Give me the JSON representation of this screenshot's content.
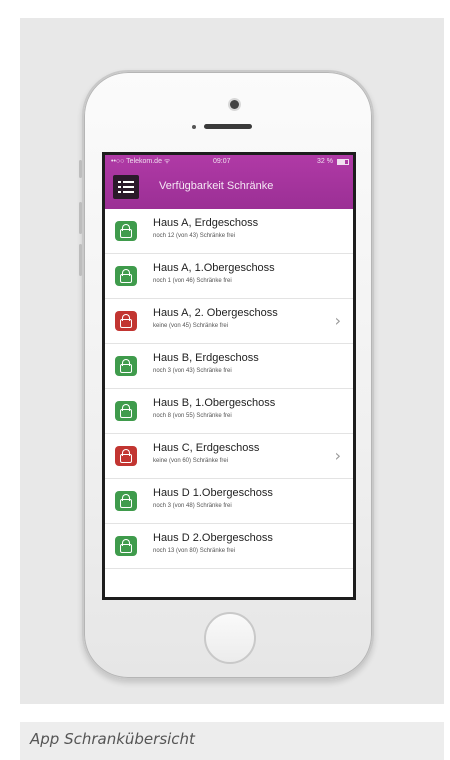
{
  "caption": "App Schrankübersicht",
  "status_bar": {
    "carrier": "••○○ Telekom.de ᯤ",
    "time": "09:07",
    "battery_text": "32 %"
  },
  "header": {
    "title": "Verfügbarkeit Schränke",
    "accent_color": "#a5359d"
  },
  "status_colors": {
    "available": "#3f9b4c",
    "full": "#c23531"
  },
  "rows": [
    {
      "title": "Haus A, Erdgeschoss",
      "subtitle": "noch 12 (von 43) Schränke frei",
      "status": "available",
      "icon": "lock-icon",
      "chevron": false
    },
    {
      "title": "Haus A, 1.Obergeschoss",
      "subtitle": "noch 1 (von 46) Schränke frei",
      "status": "available",
      "icon": "lock-icon",
      "chevron": false
    },
    {
      "title": "Haus A, 2. Obergeschoss",
      "subtitle": "keine (von 45) Schränke frei",
      "status": "full",
      "icon": "lock-icon",
      "chevron": true
    },
    {
      "title": "Haus B, Erdgeschoss",
      "subtitle": "noch 3 (von 43) Schränke frei",
      "status": "available",
      "icon": "lock-icon",
      "chevron": false
    },
    {
      "title": "Haus B, 1.Obergeschoss",
      "subtitle": "noch 8 (von 55) Schränke frei",
      "status": "available",
      "icon": "lock-icon",
      "chevron": false
    },
    {
      "title": "Haus C, Erdgeschoss",
      "subtitle": "keine (von 60) Schränke frei",
      "status": "full",
      "icon": "lock-icon",
      "chevron": true
    },
    {
      "title": "Haus D 1.Obergeschoss",
      "subtitle": "noch 3 (von 48) Schränke frei",
      "status": "available",
      "icon": "lock-icon",
      "chevron": false
    },
    {
      "title": "Haus D 2.Obergeschoss",
      "subtitle": "noch 13 (von 80) Schränke frei",
      "status": "available",
      "icon": "lock-icon",
      "chevron": false
    }
  ],
  "chevron_glyph": "›"
}
